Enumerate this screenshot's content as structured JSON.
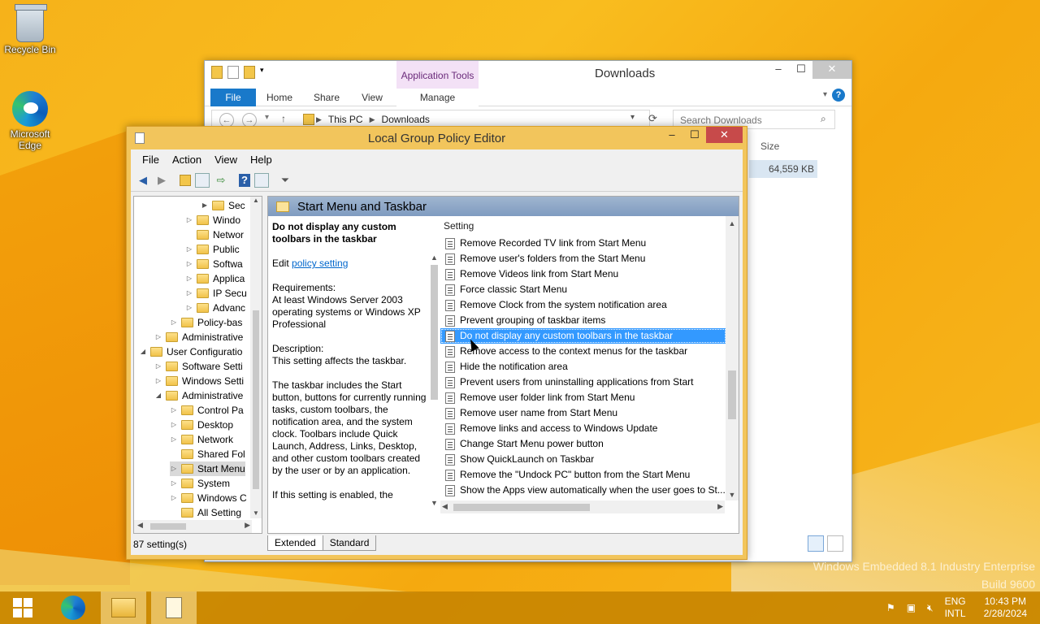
{
  "desktop": {
    "icons": [
      {
        "label": "Recycle Bin",
        "icon": "recycle-bin-icon"
      },
      {
        "label": "Microsoft Edge",
        "icon": "edge-icon"
      }
    ],
    "watermark_line1": "Windows Embedded 8.1 Industry Enterprise",
    "watermark_line2": "Build 9600"
  },
  "explorer": {
    "title": "Downloads",
    "app_tools": "Application Tools",
    "tabs": {
      "file": "File",
      "home": "Home",
      "share": "Share",
      "view": "View",
      "manage": "Manage"
    },
    "address": {
      "root": "This PC",
      "current": "Downloads"
    },
    "search_placeholder": "Search Downloads",
    "column_size": "Size",
    "size_value": "64,559 KB"
  },
  "gpe": {
    "title": "Local Group Policy Editor",
    "menu": [
      "File",
      "Action",
      "View",
      "Help"
    ],
    "tree": [
      {
        "label": "Sec",
        "level": 5,
        "expander": "▶"
      },
      {
        "label": "Windo",
        "level": 4,
        "expander": "▷"
      },
      {
        "label": "Networ",
        "level": 4,
        "expander": ""
      },
      {
        "label": "Public",
        "level": 4,
        "expander": "▷"
      },
      {
        "label": "Softwa",
        "level": 4,
        "expander": "▷"
      },
      {
        "label": "Applica",
        "level": 4,
        "expander": "▷"
      },
      {
        "label": "IP Secu",
        "level": 4,
        "expander": "▷"
      },
      {
        "label": "Advanc",
        "level": 4,
        "expander": "▷"
      },
      {
        "label": "Policy-bas",
        "level": 3,
        "expander": "▷"
      },
      {
        "label": "Administrative",
        "level": 2,
        "expander": "▷"
      },
      {
        "label": "User Configuratio",
        "level": 1,
        "expander": "◢"
      },
      {
        "label": "Software Setti",
        "level": 2,
        "expander": "▷"
      },
      {
        "label": "Windows Setti",
        "level": 2,
        "expander": "▷"
      },
      {
        "label": "Administrative",
        "level": 2,
        "expander": "◢"
      },
      {
        "label": "Control Pa",
        "level": 3,
        "expander": "▷"
      },
      {
        "label": "Desktop",
        "level": 3,
        "expander": "▷"
      },
      {
        "label": "Network",
        "level": 3,
        "expander": "▷"
      },
      {
        "label": "Shared Fol",
        "level": 3,
        "expander": ""
      },
      {
        "label": "Start Menu",
        "level": 3,
        "expander": "▷",
        "selected": true
      },
      {
        "label": "System",
        "level": 3,
        "expander": "▷"
      },
      {
        "label": "Windows C",
        "level": 3,
        "expander": "▷"
      },
      {
        "label": "All Setting",
        "level": 3,
        "expander": ""
      }
    ],
    "header": "Start Menu and Taskbar",
    "description": {
      "title": "Do not display any custom toolbars in the taskbar",
      "edit_prefix": "Edit",
      "edit_link": "policy setting",
      "req_label": "Requirements:",
      "req_text": "At least Windows Server 2003 operating systems or Windows XP Professional",
      "desc_label": "Description:",
      "desc_text": "This setting affects the taskbar.",
      "para": "The taskbar includes the Start button, buttons for currently running tasks, custom toolbars, the notification area, and the system clock. Toolbars include Quick Launch, Address, Links, Desktop, and other custom toolbars created by the user or by an application.",
      "para2": "If this setting is enabled, the"
    },
    "settings_header": "Setting",
    "settings": [
      "Remove Recorded TV link from Start Menu",
      "Remove user's folders from the Start Menu",
      "Remove Videos link from Start Menu",
      "Force classic Start Menu",
      "Remove Clock from the system notification area",
      "Prevent grouping of taskbar items",
      "Do not display any custom toolbars in the taskbar",
      "Remove access to the context menus for the taskbar",
      "Hide the notification area",
      "Prevent users from uninstalling applications from Start",
      "Remove user folder link from Start Menu",
      "Remove user name from Start Menu",
      "Remove links and access to Windows Update",
      "Change Start Menu power button",
      "Show QuickLaunch on Taskbar",
      "Remove the \"Undock PC\" button from the Start Menu",
      "Show the Apps view automatically when the user goes to St..."
    ],
    "selected_setting_index": 6,
    "tabs": [
      "Extended",
      "Standard"
    ],
    "status": "87 setting(s)"
  },
  "taskbar": {
    "lang1": "ENG",
    "lang2": "INTL",
    "time": "10:43 PM",
    "date": "2/28/2024"
  }
}
